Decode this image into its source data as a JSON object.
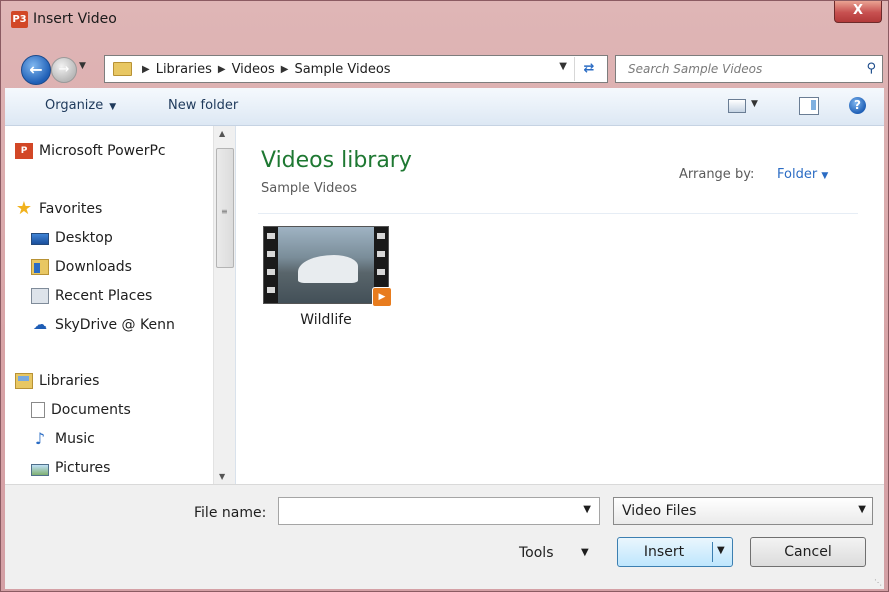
{
  "window": {
    "title": "Insert Video",
    "app_icon": "P3",
    "close_label": "X"
  },
  "nav": {
    "back_icon": "back-arrow",
    "forward_icon": "forward-arrow"
  },
  "address": {
    "breadcrumbs": [
      "Libraries",
      "Videos",
      "Sample Videos"
    ]
  },
  "search": {
    "placeholder": "Search Sample Videos"
  },
  "toolbar": {
    "organize": "Organize",
    "new_folder": "New folder"
  },
  "nav_pane": {
    "items": [
      {
        "label": "Microsoft PowerPc",
        "icon": "powerpoint-icon"
      },
      {
        "label": "Favorites",
        "icon": "star-icon"
      },
      {
        "label": "Desktop",
        "icon": "desktop-icon"
      },
      {
        "label": "Downloads",
        "icon": "downloads-icon"
      },
      {
        "label": "Recent Places",
        "icon": "recent-places-icon"
      },
      {
        "label": "SkyDrive @ Kenn",
        "icon": "skydrive-icon"
      },
      {
        "label": "Libraries",
        "icon": "libraries-icon"
      },
      {
        "label": "Documents",
        "icon": "documents-icon"
      },
      {
        "label": "Music",
        "icon": "music-icon"
      },
      {
        "label": "Pictures",
        "icon": "pictures-icon"
      }
    ]
  },
  "main": {
    "library_title": "Videos library",
    "library_subtitle": "Sample Videos",
    "arrange_label": "Arrange by:",
    "arrange_value": "Folder",
    "files": [
      {
        "name": "Wildlife"
      }
    ]
  },
  "bottom": {
    "file_name_label": "File name:",
    "file_name_value": "",
    "file_type": "Video Files",
    "tools_label": "Tools",
    "insert_label": "Insert",
    "cancel_label": "Cancel"
  },
  "colors": {
    "accent": "#2b6cc4",
    "library_title": "#1e7832",
    "title_bar": "#d8a3a6"
  }
}
